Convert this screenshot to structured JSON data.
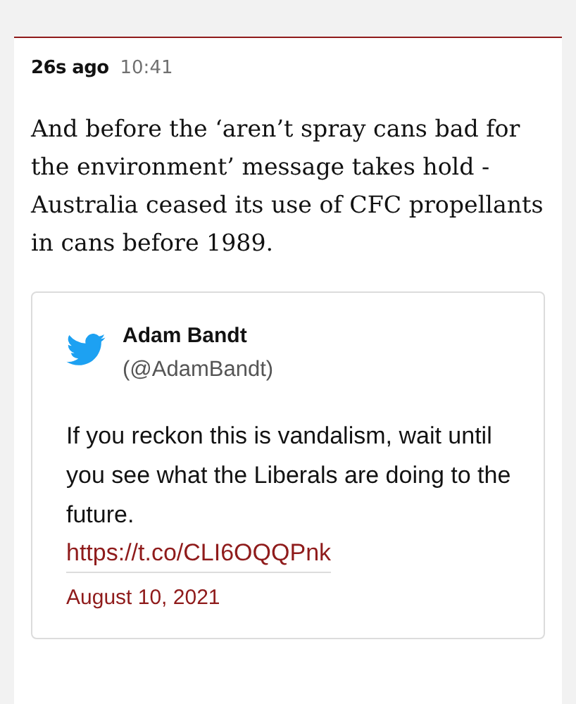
{
  "post": {
    "relative_time": "26s ago",
    "time": "10:41",
    "body": "And before the ‘aren’t spray cans bad for the environment’ message takes hold - Australia ceased its use of CFC propellants in cans before 1989."
  },
  "tweet": {
    "author": "Adam Bandt",
    "handle": "(@AdamBandt)",
    "text": "If you reckon this is vandalism, wait until you see what the Liberals are doing to the future.",
    "link": "https://t.co/CLI6OQQPnk",
    "date": "August 10, 2021"
  }
}
